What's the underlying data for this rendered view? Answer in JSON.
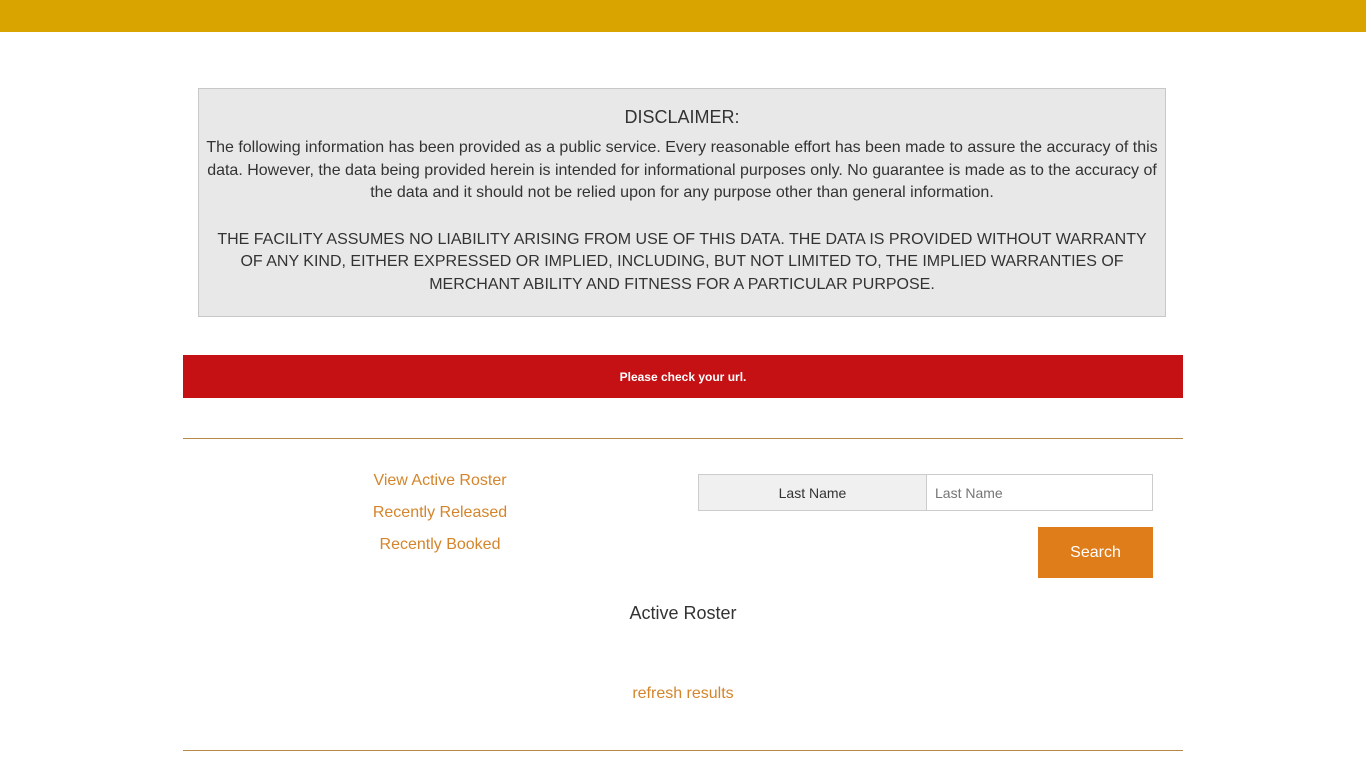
{
  "colors": {
    "top_bar": "#d9a300",
    "alert": "#c51014",
    "link": "#d4852b",
    "button": "#df7d1b",
    "rule": "#b38a45",
    "disclaimer_bg": "#e8e8e8"
  },
  "disclaimer": {
    "title": "DISCLAIMER:",
    "paragraph": "The following information has been provided as a public service. Every reasonable effort has been made to assure the accuracy of this data. However, the data being provided herein is intended for informational purposes only. No guarantee is made as to the accuracy of the data and it should not be relied upon for any purpose other than general information.",
    "liability": "THE FACILITY ASSUMES NO LIABILITY ARISING FROM USE OF THIS DATA. THE DATA IS PROVIDED WITHOUT WARRANTY OF ANY KIND, EITHER EXPRESSED OR IMPLIED, INCLUDING, BUT NOT LIMITED TO, THE IMPLIED WARRANTIES OF MERCHANT ABILITY AND FITNESS FOR A PARTICULAR PURPOSE."
  },
  "alert": {
    "message": "Please check your url."
  },
  "nav": {
    "items": [
      {
        "label": "View Active Roster"
      },
      {
        "label": "Recently Released"
      },
      {
        "label": "Recently Booked"
      }
    ]
  },
  "search": {
    "label": "Last Name",
    "placeholder": "Last Name",
    "value": "",
    "button_label": "Search"
  },
  "results": {
    "title": "Active Roster",
    "refresh_label": "refresh results"
  }
}
